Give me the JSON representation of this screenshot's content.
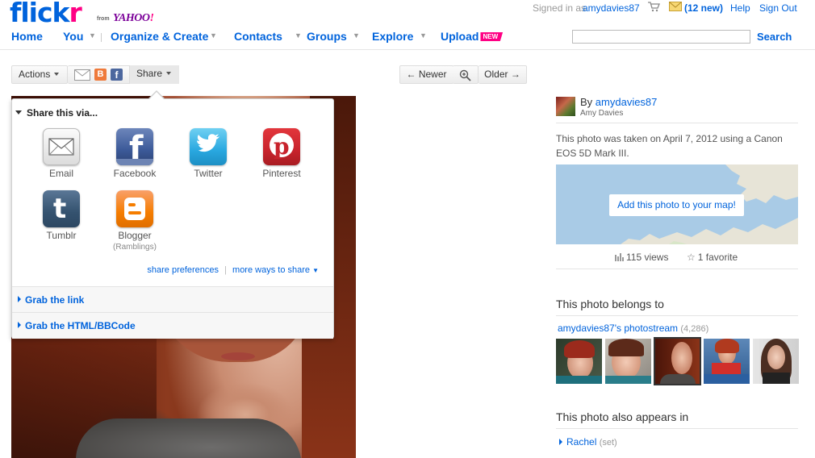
{
  "header": {
    "logo_main": "flick",
    "logo_accent": "r",
    "logo_from": "from",
    "logo_yahoo": "YAHOO",
    "logo_yahoo_bang": "!",
    "signed_in_prefix": "Signed in as",
    "username": "amydavies87",
    "mail_count": "(12 new)",
    "help": "Help",
    "sign_out": "Sign Out",
    "search_value": "",
    "search_label": "Search"
  },
  "nav": {
    "home": "Home",
    "you": "You",
    "organize": "Organize & Create",
    "contacts": "Contacts",
    "groups": "Groups",
    "explore": "Explore",
    "upload": "Upload",
    "new_badge": "NEW"
  },
  "toolbar": {
    "actions": "Actions",
    "share": "Share",
    "newer": "← Newer",
    "older": "Older →"
  },
  "share_popup": {
    "title": "Share this via...",
    "services": [
      {
        "label": "Email",
        "sub": ""
      },
      {
        "label": "Facebook",
        "sub": ""
      },
      {
        "label": "Twitter",
        "sub": ""
      },
      {
        "label": "Pinterest",
        "sub": ""
      },
      {
        "label": "Tumblr",
        "sub": ""
      },
      {
        "label": "Blogger",
        "sub": "(Ramblings)"
      }
    ],
    "share_preferences": "share preferences",
    "separator": "|",
    "more_ways": "more ways to share",
    "grab_link": "Grab the link",
    "grab_html": "Grab the HTML/BBCode"
  },
  "sidebar": {
    "by_prefix": "By",
    "owner_username": "amydavies87",
    "owner_name": "Amy Davies",
    "photo_info": "This photo was taken on April 7, 2012 using a Canon EOS 5D Mark III.",
    "map_button": "Add this photo to your map!",
    "views": "115 views",
    "favorites": "1 favorite",
    "belongs_to_title": "This photo belongs to",
    "photostream_link": "amydavies87's photostream",
    "photostream_count": "(4,286)",
    "also_in_title": "This photo also appears in",
    "set_name": "Rachel",
    "set_type": "(set)"
  },
  "colors": {
    "flickr_blue": "#0063dc",
    "flickr_pink": "#ff0084",
    "yahoo_purple": "#7b0099"
  }
}
